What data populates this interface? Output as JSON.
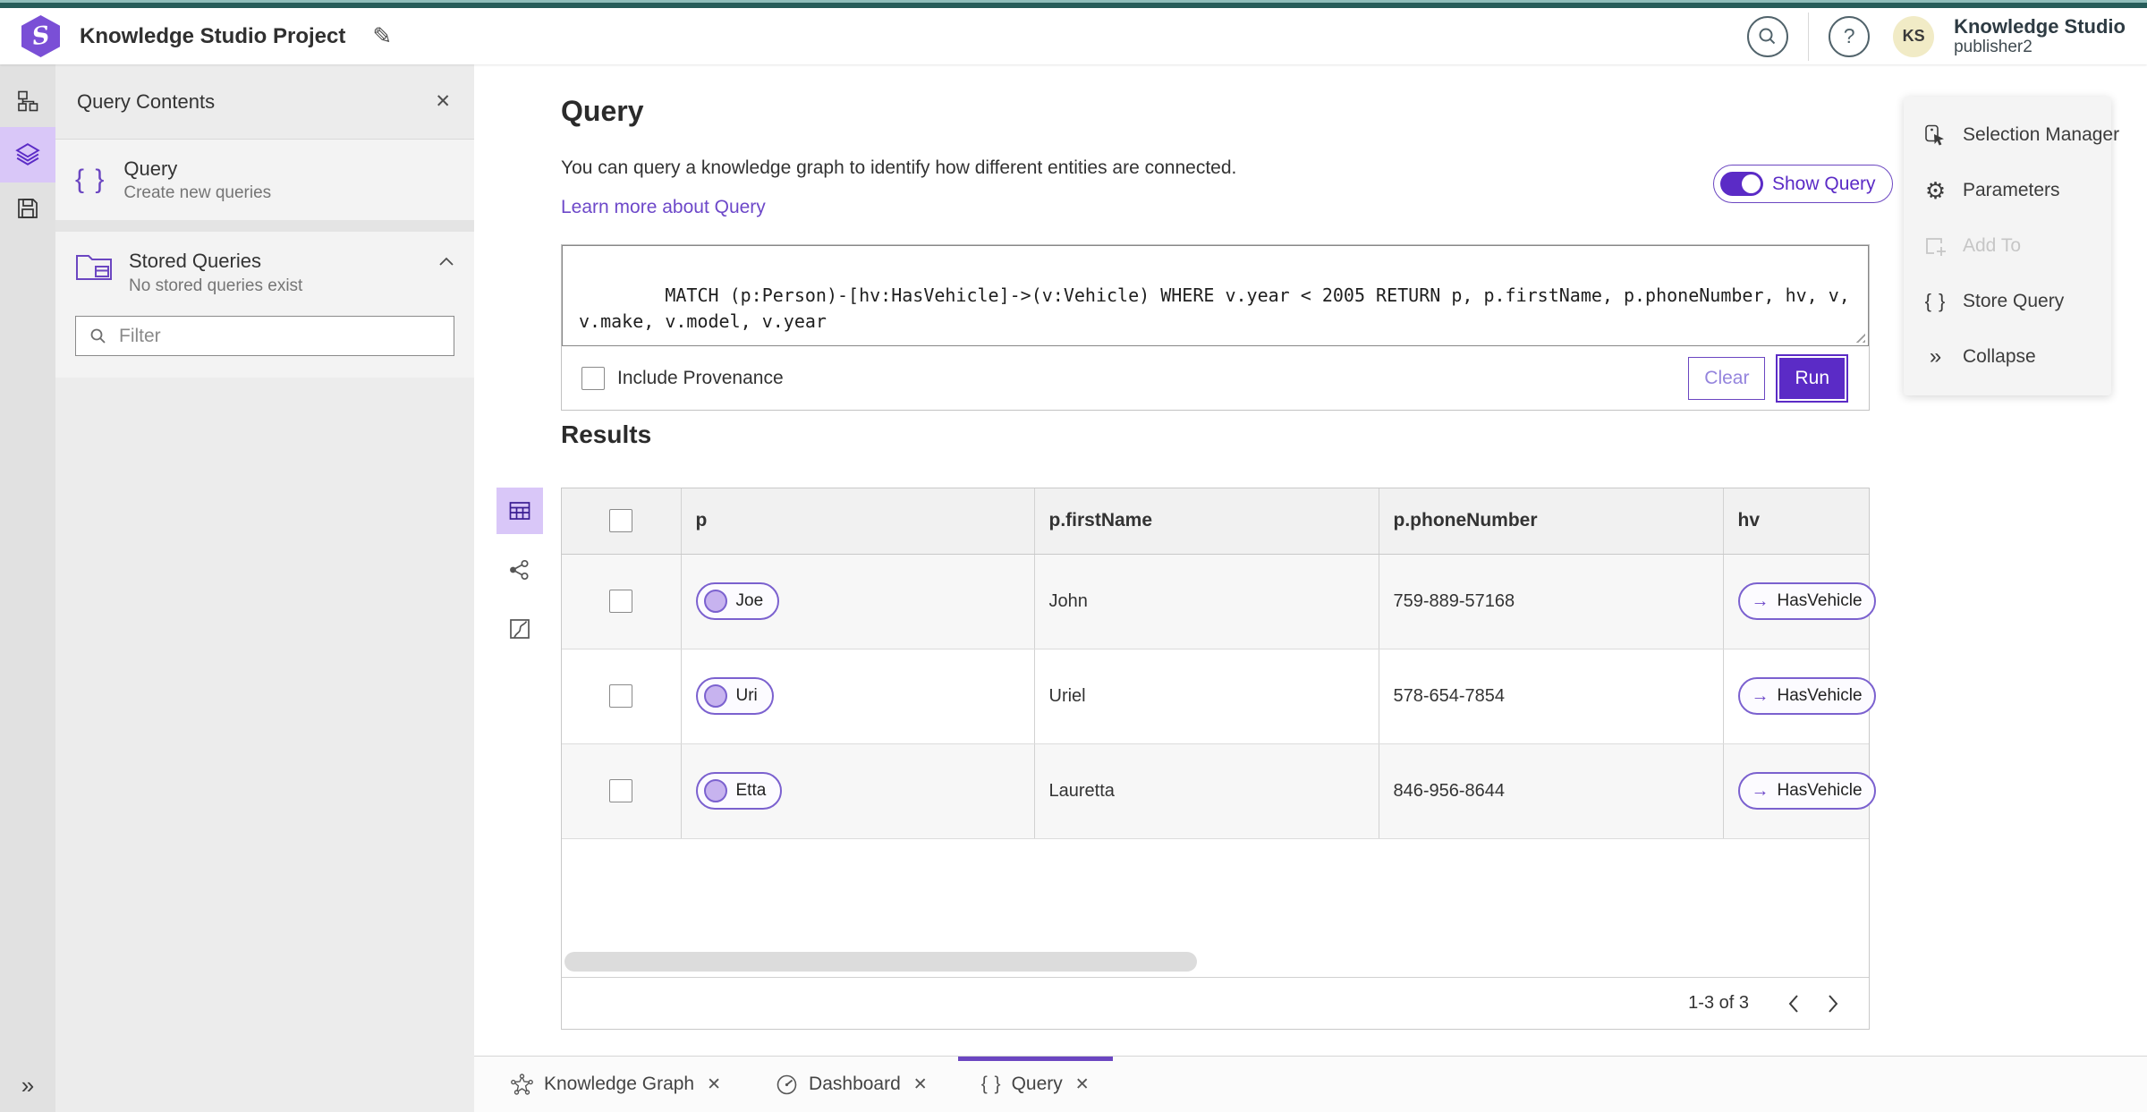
{
  "brand": {
    "logo_glyph": "S",
    "title": "Knowledge Studio Project",
    "product_name": "Knowledge Studio",
    "user_name": "publisher2",
    "avatar_initials": "KS"
  },
  "icons": {
    "edit": "✎",
    "close": "✕",
    "help": "?",
    "expand": "»",
    "collapse": "»",
    "braces": "{ }",
    "arrow_right": "→",
    "gear": "⚙"
  },
  "contents_panel": {
    "title": "Query Contents",
    "query_item": {
      "title": "Query",
      "subtitle": "Create new queries"
    },
    "stored_item": {
      "title": "Stored Queries",
      "subtitle": "No stored queries exist"
    },
    "filter_placeholder": "Filter"
  },
  "query_section": {
    "heading": "Query",
    "description": "You can query a knowledge graph to identify how different entities are connected.",
    "learn_more": "Learn more about Query",
    "show_query": "Show Query",
    "query_text": "MATCH (p:Person)-[hv:HasVehicle]->(v:Vehicle) WHERE v.year < 2005 RETURN p, p.firstName, p.phoneNumber, hv, v, v.make, v.model, v.year",
    "include_provenance": "Include Provenance",
    "clear": "Clear",
    "run": "Run"
  },
  "results": {
    "heading": "Results",
    "columns": [
      "p",
      "p.firstName",
      "p.phoneNumber",
      "hv"
    ],
    "rows": [
      {
        "p": "Joe",
        "firstName": "John",
        "phoneNumber": "759-889-57168",
        "hv": "HasVehicle"
      },
      {
        "p": "Uri",
        "firstName": "Uriel",
        "phoneNumber": "578-654-7854",
        "hv": "HasVehicle"
      },
      {
        "p": "Etta",
        "firstName": "Lauretta",
        "phoneNumber": "846-956-8644",
        "hv": "HasVehicle"
      }
    ],
    "pagination": "1-3 of 3"
  },
  "actions_panel": {
    "selection_manager": "Selection Manager",
    "parameters": "Parameters",
    "add_to": "Add To",
    "store_query": "Store Query",
    "collapse": "Collapse"
  },
  "tabs": [
    {
      "label": "Knowledge Graph"
    },
    {
      "label": "Dashboard"
    },
    {
      "label": "Query"
    }
  ]
}
